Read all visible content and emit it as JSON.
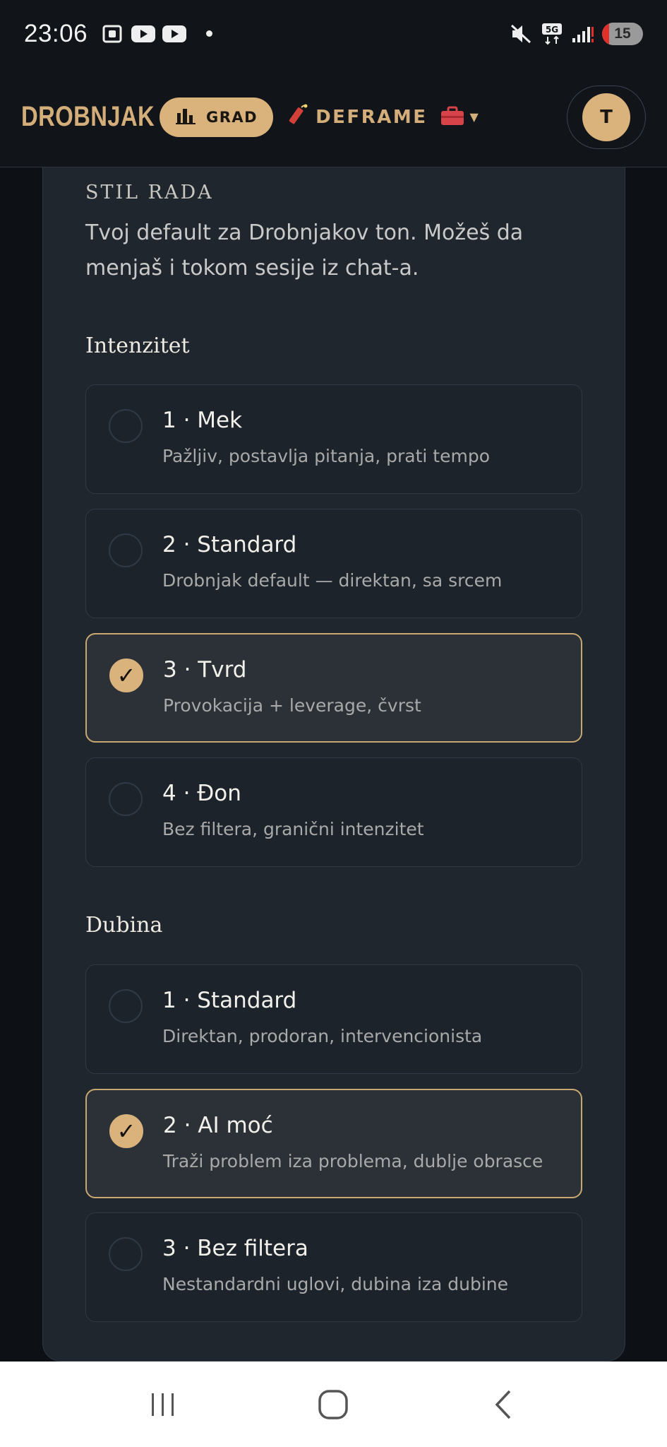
{
  "status_bar": {
    "time": "23:06",
    "battery": "15",
    "network": "5G"
  },
  "header": {
    "logo": "DROBNJAK",
    "grad_label": "GRAD",
    "deframe_label": "DEFRAME",
    "avatar_initial": "T"
  },
  "colors": {
    "accent": "#d9b27c",
    "card_bg": "#1f262e",
    "page_bg": "#0d1014"
  },
  "section": {
    "title": "STIL RADA",
    "description": "Tvoj default za Drobnjakov ton. Možeš da menjaš i tokom sesije iz chat-a."
  },
  "intensity": {
    "label": "Intenzitet",
    "options": [
      {
        "title": "1 · Mek",
        "subtitle": "Pažljiv, postavlja pitanja, prati tempo",
        "selected": false
      },
      {
        "title": "2 · Standard",
        "subtitle": "Drobnjak default — direktan, sa srcem",
        "selected": false
      },
      {
        "title": "3 · Tvrd",
        "subtitle": "Provokacija + leverage, čvrst",
        "selected": true
      },
      {
        "title": "4 · Đon",
        "subtitle": "Bez filtera, granični intenzitet",
        "selected": false
      }
    ]
  },
  "depth": {
    "label": "Dubina",
    "options": [
      {
        "title": "1 · Standard",
        "subtitle": "Direktan, prodoran, intervencionista",
        "selected": false
      },
      {
        "title": "2 · AI moć",
        "subtitle": "Traži problem iza problema, dublje obrasce",
        "selected": true
      },
      {
        "title": "3 · Bez filtera",
        "subtitle": "Nestandardni uglovi, dubina iza dubine",
        "selected": false
      }
    ]
  },
  "check_glyph": "✓"
}
